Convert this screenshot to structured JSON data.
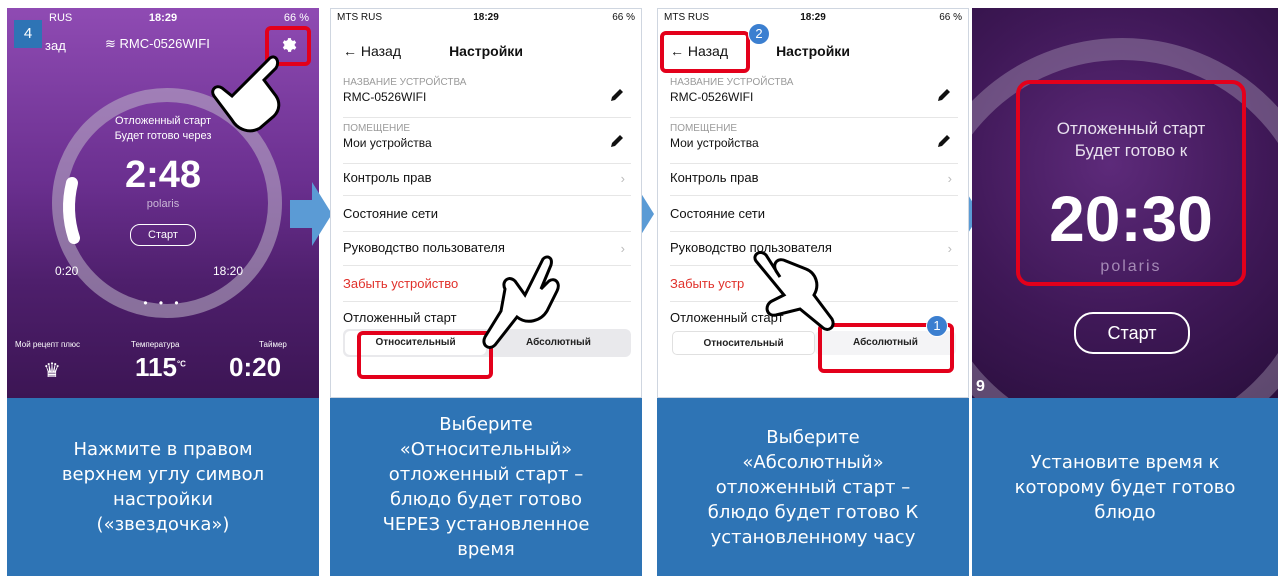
{
  "panel1": {
    "step_number": "4",
    "status_left": "RUS",
    "status_time": "18:29",
    "status_right": "66 %",
    "back_label": "зад",
    "device_name": "RMC-0526WIFI",
    "timer_title_line1": "Отложенный старт",
    "timer_title_line2": "Будет готово через",
    "timer_value": "2:48",
    "brand": "polaris",
    "start_label": "Старт",
    "time_left": "0:20",
    "time_right": "18:20",
    "bottom": {
      "recipe_label": "Мой рецепт плюс",
      "temp_label": "Температура",
      "temp_value": "115",
      "temp_unit": "°C",
      "timer_label": "Таймер",
      "timer_value": "0:20"
    },
    "caption": "Нажмите в правом\nверхнем углу символ\nнастройки\n(«звездочка»)"
  },
  "settings": {
    "status_carrier": "MTS RUS",
    "status_time": "18:29",
    "status_battery": "66 %",
    "back_label": "← Назад",
    "title": "Настройки",
    "device_name_label": "НАЗВАНИЕ УСТРОЙСТВА",
    "device_name_value": "RMC-0526WIFI",
    "room_label": "ПОМЕЩЕНИЕ",
    "room_value": "Мои устройства",
    "rights": "Контроль прав",
    "network": "Состояние сети",
    "guide": "Руководство пользователя",
    "forget": "Забыть устройство",
    "delayed": "Отложенный старт",
    "seg_relative": "Относительный",
    "seg_absolute": "Абсолютный"
  },
  "panel2": {
    "caption": "Выберите\n«Относительный»\nотложенный старт –\nблюдо будет готово\nЧЕРЕЗ установленное\nвремя"
  },
  "panel3": {
    "badge1": "1",
    "badge2": "2",
    "forget_partial": "Забыть устр",
    "network_partial": "Состояние сети",
    "caption": "Выберите\n«Абсолютный»\nотложенный старт –\nблюдо будет готово К\nустановленному  часу"
  },
  "panel4": {
    "title_line1": "Отложенный старт",
    "title_line2": "Будет готово к",
    "time": "20:30",
    "brand": "polaris",
    "start_label": "Старт",
    "edge_digit": "9",
    "caption": "Установите время к\nкоторому будет готово\nблюдо"
  },
  "colors": {
    "caption_bg": "#2e74b5",
    "highlight": "#e3001b",
    "arrow": "#5b9bd5",
    "forget_red": "#e0312b"
  }
}
